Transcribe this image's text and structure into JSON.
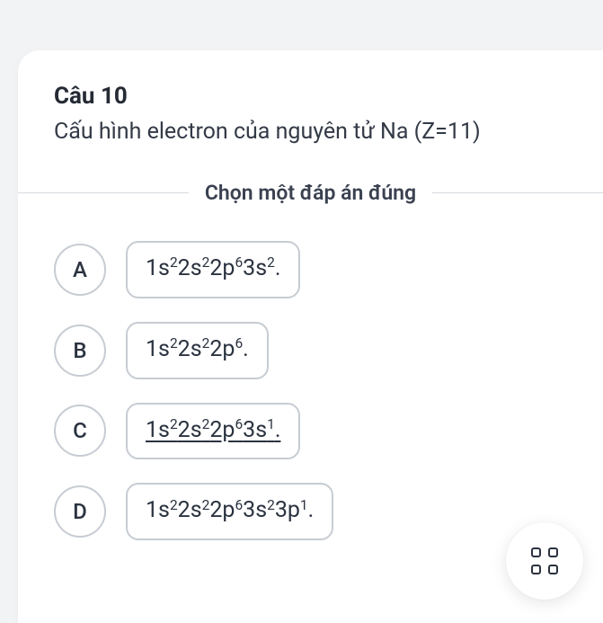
{
  "question": {
    "title": "Câu 10",
    "text": "Cấu hình electron của nguyên tử Na (Z=11)",
    "choose_label": "Chọn một đáp án đúng"
  },
  "options": [
    {
      "letter": "A",
      "segments": [
        [
          "1s",
          "2"
        ],
        [
          "2s",
          "2"
        ],
        [
          "2p",
          "6"
        ],
        [
          "3s",
          "2"
        ]
      ],
      "suffix": ".",
      "underlined": false
    },
    {
      "letter": "B",
      "segments": [
        [
          "1s",
          "2"
        ],
        [
          "2s",
          "2"
        ],
        [
          "2p",
          "6"
        ]
      ],
      "suffix": ".",
      "underlined": false
    },
    {
      "letter": "C",
      "segments": [
        [
          "1s",
          "2"
        ],
        [
          "2s",
          "2"
        ],
        [
          "2p",
          "6"
        ],
        [
          "3s",
          "1"
        ]
      ],
      "suffix": ".",
      "underlined": true
    },
    {
      "letter": "D",
      "segments": [
        [
          "1s",
          "2"
        ],
        [
          "2s",
          "2"
        ],
        [
          "2p",
          "6"
        ],
        [
          "3s",
          "2"
        ],
        [
          "3p",
          "1"
        ]
      ],
      "suffix": ".",
      "underlined": false
    }
  ],
  "icons": {
    "grid": "grid-icon"
  }
}
